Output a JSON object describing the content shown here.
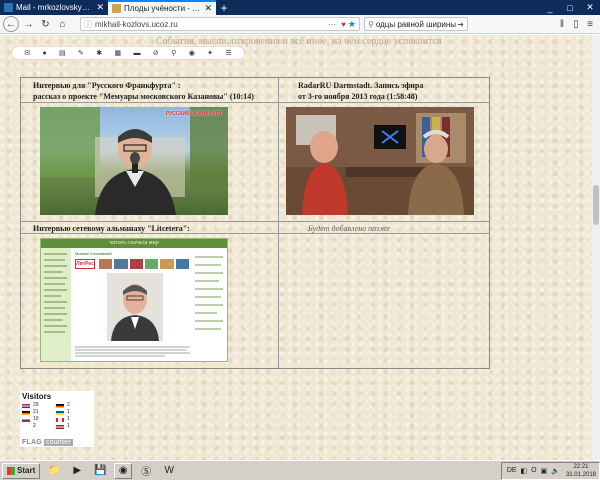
{
  "browser": {
    "tabs": [
      {
        "title": "Mail - mrkozlovsky@hotmail.com",
        "active": false
      },
      {
        "title": "Плоды учёности - Главная стра",
        "active": true
      }
    ],
    "new_tab": "+",
    "url": "mikhail-kozlovs.ucoz.ru",
    "search_value": "одцы равной ширины",
    "window_controls": [
      "_",
      "□",
      "✕"
    ]
  },
  "site": {
    "tagline": "События, мысли, откровения и всё иное, на чём сердце успокоится"
  },
  "grid": {
    "cell1": {
      "line1": "Интервью для \"Русского Франкфурта\" :",
      "line2": "рассказ о проекте \"Мемуары московского Казановы\" (10:14)",
      "photo_logo": "РУССКИЙ ФРАНКФУРТ"
    },
    "cell2": {
      "line1": "RadarRU Darmstadt. Запись эфира",
      "line2": "от 3-го ноября 2013 года (1:58:48)"
    },
    "cell3": {
      "line1": "Интервью сетевому альманаху \"Litcetera\":",
      "site_header": "читать сначала мир",
      "site_name": "Михаил Козловский",
      "site_logo": "ЛитРес"
    },
    "cell4": {
      "line1": "Будет добавлено позже"
    }
  },
  "visitors": {
    "title": "Visitors",
    "rows": [
      [
        {
          "flag": "us",
          "count": "29"
        },
        {
          "flag": "de",
          "count": "2"
        }
      ],
      [
        {
          "flag": "de",
          "count": "21"
        },
        {
          "flag": "ua",
          "count": "1"
        }
      ],
      [
        {
          "flag": "ru",
          "count": "10"
        },
        {
          "flag": "ca",
          "count": "1"
        }
      ],
      [
        {
          "flag": "il",
          "count": "2"
        },
        {
          "flag": "lv",
          "count": "1"
        }
      ]
    ],
    "brand_left": "FLAG",
    "brand_right": "counter"
  },
  "taskbar": {
    "start_label": "Start",
    "lang": "DE",
    "time": "22:21",
    "date": "31.01.2018"
  },
  "colors": {
    "tab_strip": "#0d2c5c",
    "accent": "#0a84ff",
    "page_bg": "#efe7d2"
  }
}
